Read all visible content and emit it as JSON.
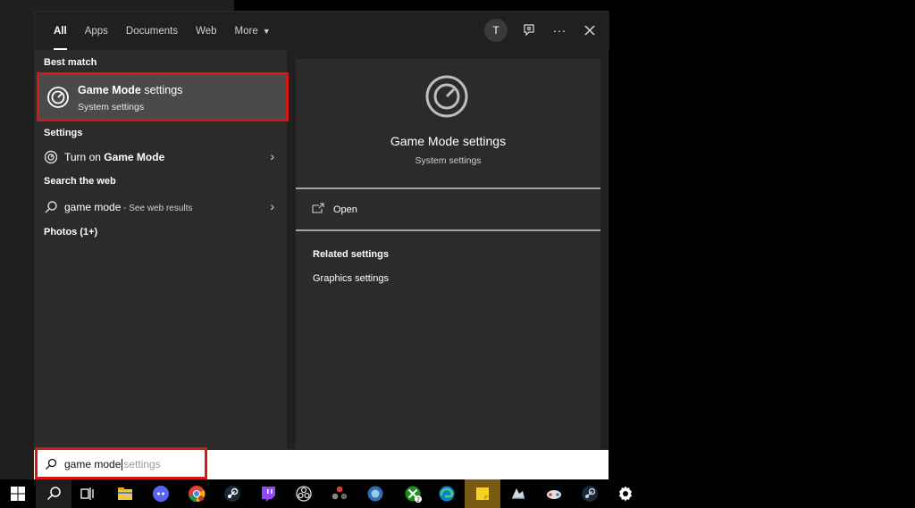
{
  "tabs": [
    {
      "label": "All"
    },
    {
      "label": "Apps"
    },
    {
      "label": "Documents"
    },
    {
      "label": "Web"
    },
    {
      "label": "More"
    }
  ],
  "account_initial": "T",
  "sections": {
    "best_match": "Best match",
    "settings": "Settings",
    "search_web": "Search the web",
    "photos": "Photos (1+)"
  },
  "best_match_item": {
    "title_bold": "Game Mode",
    "title_rest": " settings",
    "subtitle": "System settings"
  },
  "settings_item": {
    "prefix": "Turn on ",
    "bold": "Game Mode"
  },
  "web_item": {
    "query": "game mode",
    "suffix": " - See web results"
  },
  "preview": {
    "title": "Game Mode settings",
    "subtitle": "System settings",
    "open_label": "Open",
    "related_label": "Related settings",
    "related_link": "Graphics settings"
  },
  "search_box": {
    "typed": "game mode",
    "ghost": "settings"
  },
  "colors": {
    "highlight_red": "#d81616",
    "pane_bg": "#2b2b2b",
    "window_bg": "#202020"
  },
  "taskbar_icons": [
    "windows-start-icon",
    "search-icon",
    "task-view-icon",
    "file-explorer-icon",
    "discord-icon",
    "chrome-icon",
    "steam-icon",
    "twitch-icon",
    "obs-icon",
    "davinci-icon",
    "app-blue-icon",
    "xbox-icon",
    "edge-icon",
    "sticky-notes-icon",
    "app-gray-icon",
    "game-app-icon",
    "steam-2-icon",
    "settings-gear-icon"
  ],
  "xbox_badge": "2"
}
